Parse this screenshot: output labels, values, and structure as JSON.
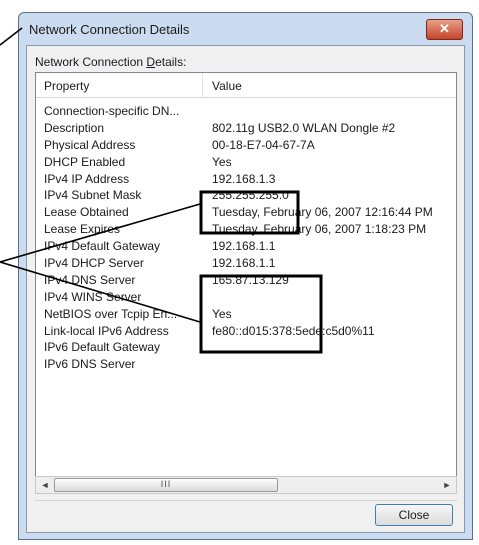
{
  "window": {
    "title": "Network Connection Details",
    "close_glyph": "✕"
  },
  "label": {
    "prefix": "Network Connection ",
    "accel": "D",
    "suffix": "etails:"
  },
  "columns": {
    "property": "Property",
    "value": "Value"
  },
  "rows": [
    {
      "property": "Connection-specific DN...",
      "value": ""
    },
    {
      "property": "Description",
      "value": "802.11g USB2.0 WLAN Dongle #2"
    },
    {
      "property": "Physical Address",
      "value": "00-18-E7-04-67-7A"
    },
    {
      "property": "DHCP Enabled",
      "value": "Yes"
    },
    {
      "property": "IPv4 IP Address",
      "value": "192.168.1.3"
    },
    {
      "property": "IPv4 Subnet Mask",
      "value": "255.255.255.0"
    },
    {
      "property": "Lease Obtained",
      "value": "Tuesday, February 06, 2007 12:16:44 PM"
    },
    {
      "property": "Lease Expires",
      "value": "Tuesday, February 06, 2007 1:18:23 PM"
    },
    {
      "property": "IPv4 Default Gateway",
      "value": "192.168.1.1"
    },
    {
      "property": "IPv4 DHCP Server",
      "value": "192.168.1.1"
    },
    {
      "property": "IPv4 DNS Server",
      "value": "165.87.13.129"
    },
    {
      "property": "IPv4 WINS Server",
      "value": ""
    },
    {
      "property": "NetBIOS over Tcpip En...",
      "value": "Yes"
    },
    {
      "property": "Link-local IPv6 Address",
      "value": "fe80::d015:378:5ede:c5d0%11"
    },
    {
      "property": "IPv6 Default Gateway",
      "value": ""
    },
    {
      "property": "IPv6 DNS Server",
      "value": ""
    }
  ],
  "scrollbar": {
    "left_glyph": "◄",
    "right_glyph": "►",
    "grip": "III"
  },
  "close_button": {
    "label": "Close"
  },
  "colors": {
    "callout": "#000000",
    "titlebar": "#cbdcf0",
    "close_red": "#c5452a"
  },
  "icons": {
    "close": "close-icon",
    "scroll_left": "arrow-left-icon",
    "scroll_right": "arrow-right-icon"
  }
}
